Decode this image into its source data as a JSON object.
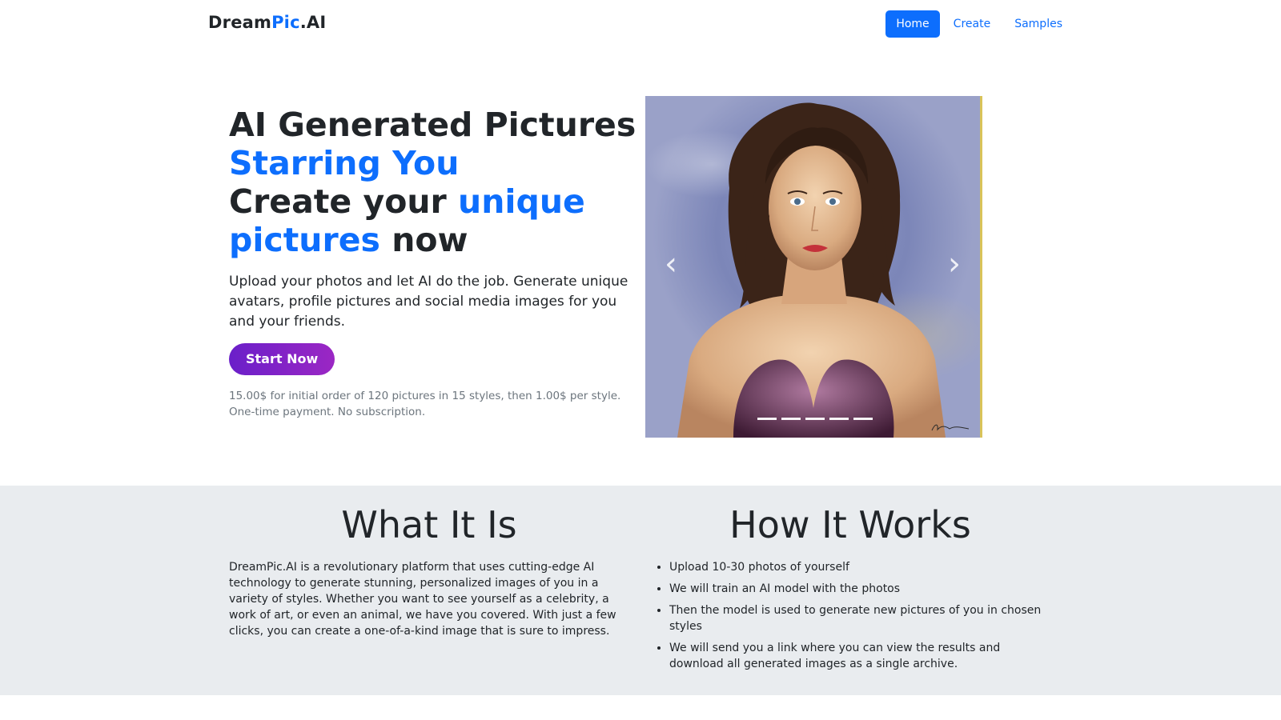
{
  "navbar": {
    "brand_part1": "Dream",
    "brand_part2": "Pic",
    "brand_part3": ".AI",
    "links": [
      "Home",
      "Create",
      "Samples"
    ]
  },
  "hero": {
    "title_line1": "AI Generated Pictures",
    "title_line2": "Starring You",
    "title_line3_a": "Create your ",
    "title_line3_b": "unique",
    "title_line4_a": "pictures",
    "title_line4_b": " now",
    "lead": "Upload your photos and let AI do the job. Generate unique avatars, profile pictures and social media images for you and your friends.",
    "cta_label": "Start Now",
    "price_note_line1": "15.00$ for initial order of 120 pictures in 15 styles, then 1.00$ per style.",
    "price_note_line2": "One-time payment. No subscription."
  },
  "carousel": {
    "prev_icon": "chevron-left-icon",
    "next_icon": "chevron-right-icon",
    "slide_count": 5,
    "active_slide": 1
  },
  "what_it_is": {
    "heading": "What It Is",
    "body": "DreamPic.AI is a revolutionary platform that uses cutting-edge AI technology to generate stunning, personalized images of you in a variety of styles. Whether you want to see yourself as a celebrity, a work of art, or even an animal, we have you covered. With just a few clicks, you can create a one-of-a-kind image that is sure to impress."
  },
  "how_it_works": {
    "heading": "How It Works",
    "steps": [
      "Upload 10-30 photos of yourself",
      "We will train an AI model with the photos",
      "Then the model is used to generate new pictures of you in chosen styles",
      "We will send you a link where you can view the results and download all generated images as a single archive."
    ]
  },
  "colors": {
    "primary": "#0d6efd",
    "cta_gradient_start": "#6a1fc9",
    "cta_gradient_end": "#9b27c4",
    "section_bg": "#e9ecef"
  }
}
